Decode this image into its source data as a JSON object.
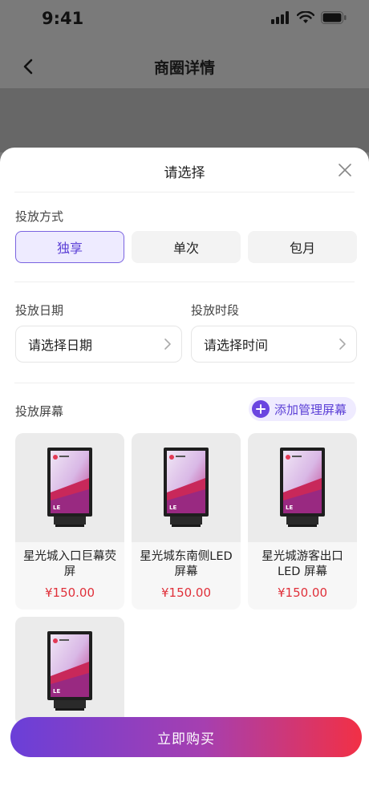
{
  "status_bar": {
    "time": "9:41"
  },
  "nav": {
    "title": "商圈详情"
  },
  "sheet": {
    "title": "请选择",
    "mode": {
      "label": "投放方式",
      "options": [
        {
          "label": "独享",
          "selected": true
        },
        {
          "label": "单次",
          "selected": false
        },
        {
          "label": "包月",
          "selected": false
        }
      ]
    },
    "date": {
      "label": "投放日期",
      "placeholder": "请选择日期"
    },
    "time": {
      "label": "投放时段",
      "placeholder": "请选择时间"
    },
    "screens": {
      "label": "投放屏幕",
      "add_label": "添加管理屏幕",
      "items": [
        {
          "name": "星光城入口巨幕荧屏",
          "price": "¥150.00"
        },
        {
          "name": "星光城东南侧LED屏幕",
          "price": "¥150.00"
        },
        {
          "name": "星光城游客出口LED 屏幕",
          "price": "¥150.00"
        },
        {
          "name": "",
          "price": ""
        }
      ]
    }
  },
  "footer": {
    "buy_label": "立即购买"
  },
  "colors": {
    "accent": "#5b3fd6",
    "price": "#e0303a",
    "gradient_start": "#6a3fd8",
    "gradient_end": "#f23045"
  }
}
